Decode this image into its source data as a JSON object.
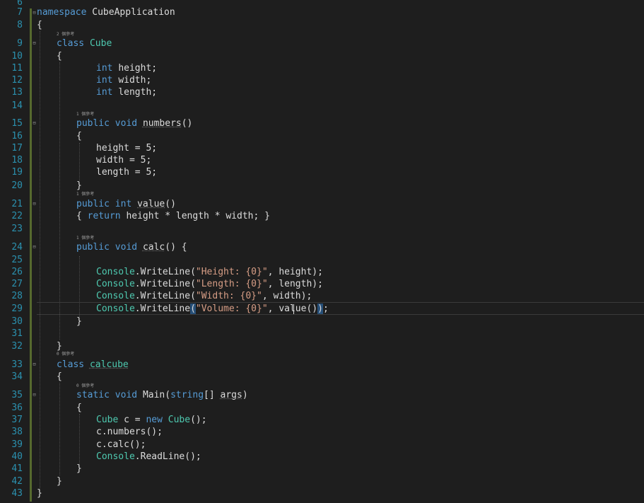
{
  "editor": {
    "line_numbers": [
      "6",
      "7",
      "8",
      "9",
      "10",
      "11",
      "12",
      "13",
      "14",
      "15",
      "16",
      "17",
      "18",
      "19",
      "20",
      "21",
      "22",
      "23",
      "24",
      "25",
      "26",
      "27",
      "28",
      "29",
      "30",
      "31",
      "32",
      "33",
      "34",
      "35",
      "36",
      "37",
      "38",
      "39",
      "40",
      "41",
      "42",
      "43"
    ],
    "ref_counts": {
      "cube": "2 個參考",
      "numbers": "1 個參考",
      "value": "1 個參考",
      "calc": "1 個參考",
      "calcube": "0 個參考",
      "main": "0 個參考"
    },
    "tokens": {
      "namespace": "namespace",
      "namespace_name": "CubeApplication",
      "class": "class",
      "cube": "Cube",
      "int": "int",
      "public": "public",
      "void": "void",
      "return": "return",
      "static": "static",
      "string": "string",
      "new": "new",
      "console": "Console",
      "calcube": "calcube",
      "main": "Main",
      "numbers": "numbers",
      "value": "value",
      "calc": "calc",
      "args": "args",
      "writeline": "WriteLine",
      "readline": "ReadLine",
      "height": "height",
      "width": "width",
      "length": "length",
      "c": "c",
      "str_height": "\"Height: {0}\"",
      "str_length": "\"Length: {0}\"",
      "str_width": "\"Width: {0}\"",
      "str_volume": "\"Volume: {0}\""
    }
  }
}
